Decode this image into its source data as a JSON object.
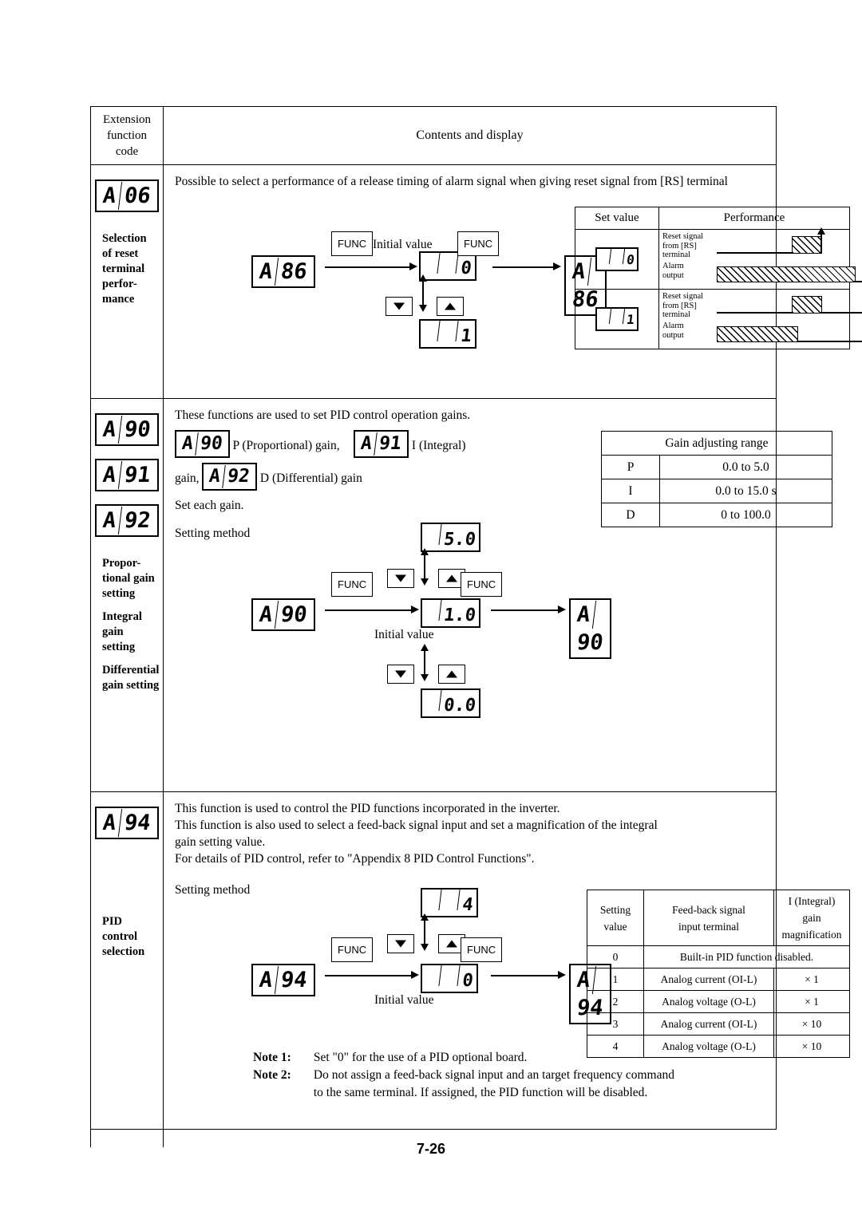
{
  "page": {
    "number": "7-26"
  },
  "table": {
    "header": {
      "code_col": [
        "Extension",
        "function",
        "code"
      ],
      "contents_col": "Contents and display"
    }
  },
  "rows": [
    {
      "codes": [
        "A06"
      ],
      "label_lines": [
        "Selection",
        "of reset",
        "terminal",
        "perfor-",
        "mance"
      ],
      "text": "Possible to select a performance of a release timing of alarm signal when giving reset signal from [RS] terminal",
      "flow": {
        "code_left": "A86",
        "code_right": "A86",
        "func_label": "FUNC",
        "initial_value_label": "Initial value",
        "value_top": "0",
        "value_bottom": "1"
      },
      "perf_table": {
        "headers": [
          "Set value",
          "Performance"
        ],
        "rows": [
          {
            "value": "0",
            "labels": [
              "Reset signal",
              "from [RS]",
              "terminal",
              "Alarm",
              "output"
            ]
          },
          {
            "value": "1",
            "labels": [
              "Reset signal",
              "from [RS]",
              "terminal",
              "Alarm",
              "output"
            ]
          }
        ]
      }
    },
    {
      "codes": [
        "A90",
        "A91",
        "A92"
      ],
      "label_lines": [
        "Propor-",
        "tional gain",
        "setting",
        "Integral",
        "gain",
        "setting",
        "Differential",
        "gain setting"
      ],
      "text_lines": [
        "These functions are used to set PID control operation gains.",
        "P (Proportional) gain,",
        "I (Integral)",
        "gain,",
        "D (Differential) gain",
        "Set each gain.",
        "Setting method"
      ],
      "inline_codes": [
        "A90",
        "A91",
        "A92"
      ],
      "flow": {
        "code_left": "A90",
        "code_right": "A90",
        "func_label": "FUNC",
        "initial_value_label": "Initial value",
        "value_top": "5.0",
        "value_mid": "1.0",
        "value_bottom": "0.0"
      },
      "gain_table": {
        "title": "Gain adjusting range",
        "rows": [
          {
            "key": "P",
            "range": "0.0 to 5.0"
          },
          {
            "key": "I",
            "range": "0.0 to 15.0 s"
          },
          {
            "key": "D",
            "range": "0 to 100.0"
          }
        ]
      }
    },
    {
      "codes": [
        "A94"
      ],
      "label_lines": [
        "PID",
        "control",
        "selection"
      ],
      "text_lines": [
        "This function is used to control the PID functions incorporated in the inverter.",
        "This function is also used to select a feed-back signal input and set a magnification of the integral",
        "gain setting value.",
        "For details of PID control, refer to \"Appendix 8  PID Control Functions\".",
        "Setting method"
      ],
      "flow": {
        "code_left": "A94",
        "code_right": "A94",
        "func_label": "FUNC",
        "initial_value_label": "Initial value",
        "value_top": "4",
        "value_bottom": "0"
      },
      "pid_table": {
        "headers": [
          "Setting value",
          "Feed-back signal input terminal",
          "I (Integral) gain magnification"
        ],
        "header_parts": {
          "c1l1": "Setting",
          "c1l2": "value",
          "c2l1": "Feed-back signal",
          "c2l2": "input terminal",
          "c3l1": "I (Integral) gain",
          "c3l2": "magnification"
        },
        "rows": [
          {
            "value": "0",
            "terminal": "Built-in PID function disabled.",
            "mag": ""
          },
          {
            "value": "1",
            "terminal": "Analog current (OI-L)",
            "mag": "× 1"
          },
          {
            "value": "2",
            "terminal": "Analog voltage (O-L)",
            "mag": "× 1"
          },
          {
            "value": "3",
            "terminal": "Analog current (OI-L)",
            "mag": "× 10"
          },
          {
            "value": "4",
            "terminal": "Analog voltage (O-L)",
            "mag": "× 10"
          }
        ]
      },
      "notes": [
        {
          "tag": "Note 1:",
          "text": "Set \"0\" for the use of a PID optional board."
        },
        {
          "tag": "Note 2:",
          "text": "Do not assign a feed-back signal input and an target frequency command"
        },
        {
          "tag": "",
          "text": "to the same terminal.  If assigned, the PID function will be disabled."
        }
      ]
    }
  ]
}
